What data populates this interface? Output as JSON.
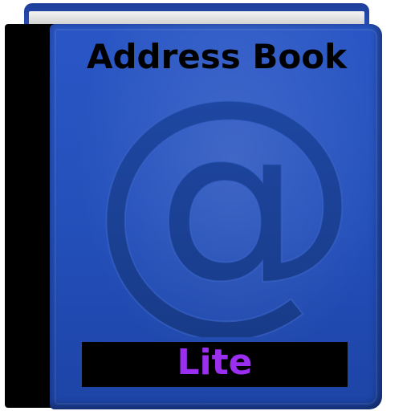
{
  "app": {
    "title": "Address Book",
    "badge_label": "Lite",
    "symbol": "@",
    "colors": {
      "cover": "#2450bb",
      "spine": "#000000",
      "title_text": "#000000",
      "badge_background": "#000000",
      "badge_text": "#9b2ff0",
      "symbol": "#1c3f8f"
    },
    "icons": [
      "address-book-icon",
      "at-sign-icon"
    ]
  }
}
